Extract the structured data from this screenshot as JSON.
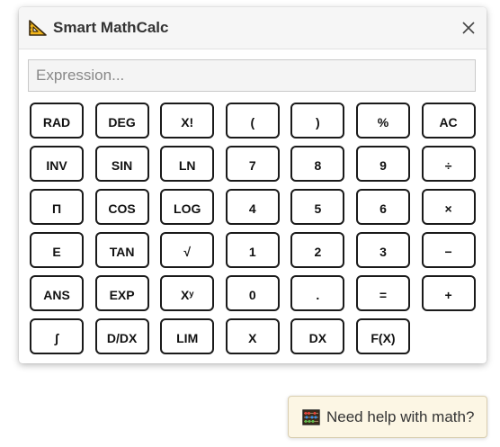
{
  "window": {
    "title": "Smart MathCalc",
    "icon": "set-square-icon",
    "close_icon": "close-icon"
  },
  "expression": {
    "value": "",
    "placeholder": "Expression..."
  },
  "keypad": {
    "rows": [
      [
        "RAD",
        "DEG",
        "X!",
        "(",
        ")",
        "%",
        "AC"
      ],
      [
        "INV",
        "SIN",
        "LN",
        "7",
        "8",
        "9",
        "÷"
      ],
      [
        "Π",
        "COS",
        "LOG",
        "4",
        "5",
        "6",
        "×"
      ],
      [
        "E",
        "TAN",
        "√",
        "1",
        "2",
        "3",
        "−"
      ],
      [
        "ANS",
        "EXP",
        "Xʸ",
        "0",
        ".",
        "=",
        "+"
      ],
      [
        "∫",
        "D/DX",
        "LIM",
        "X",
        "DX",
        "F(X)"
      ]
    ]
  },
  "help": {
    "icon": "abacus-icon",
    "label": "Need help with math?"
  },
  "colors": {
    "titlebar_bg": "#f6f6f6",
    "key_border": "#1a1a1a",
    "help_bg": "#fcf6e4",
    "icon_yellow": "#f2b51a"
  }
}
